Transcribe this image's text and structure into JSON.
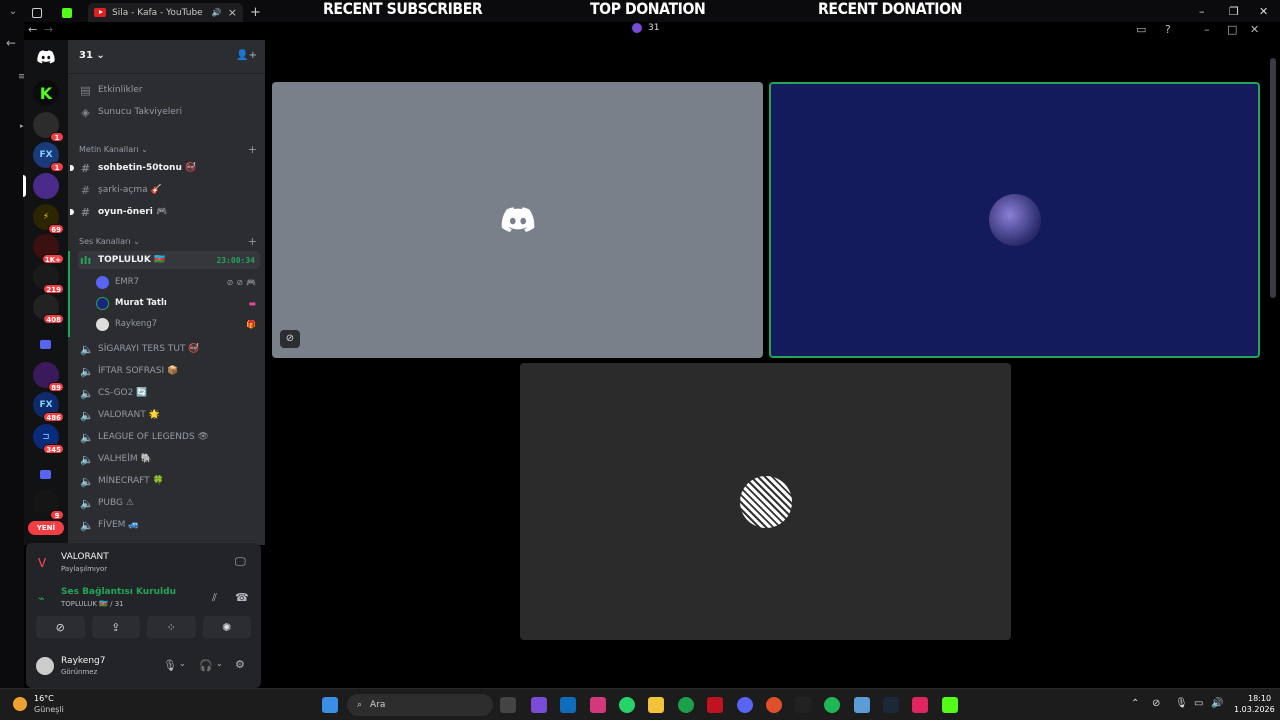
{
  "browser": {
    "tab_title": "Sila - Kafa - YouTube",
    "new_tab": "+",
    "close_tab": "×",
    "overlay": {
      "recent_subscriber": "RECENT SUBSCRIBER",
      "top_donation": "TOP DONATION",
      "recent_donation": "RECENT DONATION"
    }
  },
  "title_bar": {
    "guild_title": "31"
  },
  "server_rail": {
    "badges": [
      "1",
      "1",
      "69",
      "1K+",
      "219",
      "408",
      "89",
      "486",
      "345",
      "9"
    ],
    "new_label": "YENİ"
  },
  "sidebar": {
    "guild_name": "31",
    "top_items": [
      "Etkinlikler",
      "Sunucu Takviyeleri"
    ],
    "text_category": "Metin Kanalları",
    "text_channels": [
      "sohbetin-50tonu 🚭",
      "şarki-açma 🎸",
      "oyun-öneri 🎮"
    ],
    "voice_category": "Ses Kanalları",
    "active_voice": {
      "name": "TOPLULUK 🇦🇿",
      "timer": "23:00:34"
    },
    "voice_users": [
      "EMR7",
      "Murat Tatlı",
      "Raykeng7"
    ],
    "voice_channels": [
      "SİGARAYI TERS TUT 🚭",
      "İFTAR SOFRASI 📦",
      "CS-GO2 🔄",
      "VALORANT 🌟",
      "LEAGUE OF LEGENDS 👁",
      "VALHEİM 🐘",
      "MİNECRAFT 🍀",
      "PUBG ⚠",
      "FİVEM 🚙"
    ]
  },
  "user_area": {
    "activity_title": "VALORANT",
    "activity_sub": "Paylaşılmıyor",
    "voice_status": "Ses Bağlantısı Kuruldu",
    "voice_channel": "TOPLULUK 🇦🇿 / 31",
    "username": "Raykeng7",
    "user_status": "Görünmez"
  },
  "taskbar": {
    "weather_temp": "16°C",
    "weather_desc": "Güneşli",
    "search_placeholder": "Ara",
    "time": "18:10",
    "date": "1.03.2026"
  },
  "colors": {
    "discord_blurple": "#5865f2",
    "voice_green": "#23a55a",
    "badge_red": "#f23f43",
    "sidebar_bg": "#2b2d31",
    "tile_gray": "#7a808a",
    "tile_navy": "#141b5c"
  }
}
